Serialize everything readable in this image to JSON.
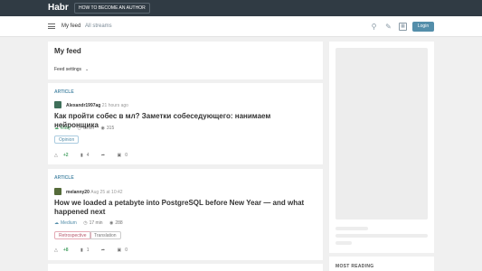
{
  "topbar": {
    "logo": "Habr",
    "become_author": "HOW TO BECOME AN AUTHOR"
  },
  "nav": {
    "tabs": [
      "My feed",
      "All streams"
    ],
    "login": "Login"
  },
  "feed": {
    "title": "My feed",
    "settings": "Feed settings"
  },
  "posts": [
    {
      "type": "ARTICLE",
      "author": "Alexandr1997ag",
      "time": "21 hours ago",
      "title": "Как пройти собес в мл? Заметки собеседующего: нанимаем нейронщика",
      "level": "Easy",
      "read_time": "6 min",
      "views": "315",
      "tags": [
        "Opinion"
      ],
      "score": "+2",
      "bookmarks": "4",
      "comments": "0"
    },
    {
      "type": "ARTICLE",
      "author": "melanny20",
      "time": "Aug 25 at 10:42",
      "title": "How we loaded a petabyte into PostgreSQL before New Year — and what happened next",
      "level": "Medium",
      "read_time": "17 min",
      "views": "288",
      "tags": [
        "Retrospective",
        "Translation"
      ],
      "score": "+8",
      "bookmarks": "1",
      "comments": "0"
    }
  ],
  "sidebar": {
    "most_reading": "MOST READING"
  }
}
